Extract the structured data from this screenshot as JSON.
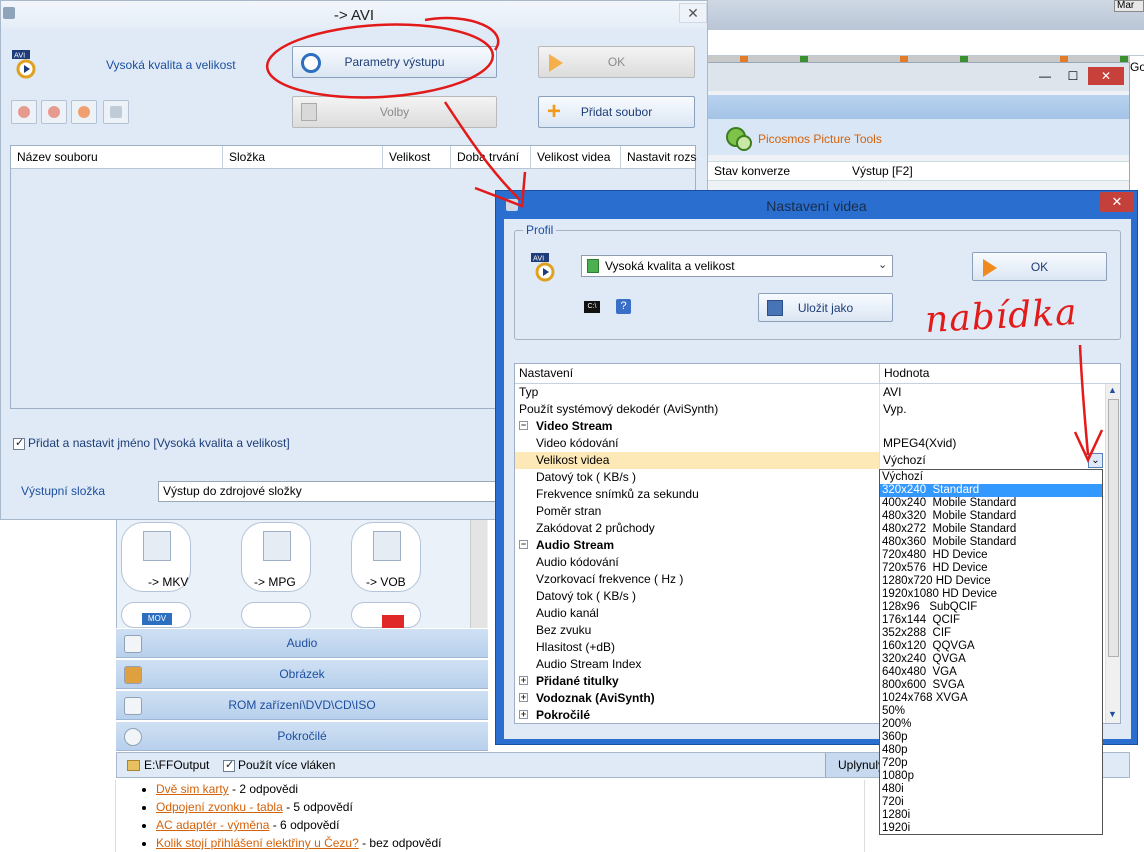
{
  "background": {
    "user_btn": "Mar",
    "gadget_letter": "Go",
    "forum_posts": [
      {
        "title": "Dvě sim karty",
        "replies": " - 2 odpovědi"
      },
      {
        "title": "Odpojení zvonku - tabla",
        "replies": " - 5 odpovědí"
      },
      {
        "title": "AC adaptér - výměna",
        "replies": " - 6 odpovědí"
      },
      {
        "title": "Kolik stojí přihlášení elektřiny u Čezu?",
        "replies": " - bez odpovědí"
      }
    ]
  },
  "picosmos": {
    "title": "Picosmos Picture Tools",
    "col_status": "Stav konverze",
    "col_output": "Výstup [F2]",
    "minimize": "—",
    "maximize": "☐",
    "close": "✕"
  },
  "main": {
    "title": "-> AVI",
    "close": "✕",
    "profile_label": "Vysoká kvalita a velikost",
    "params_button": "Parametry výstupu",
    "ok_button": "OK",
    "options_button": "Volby",
    "add_file_button": "Přidat soubor",
    "table_headers": [
      "Název souboru",
      "Složka",
      "Velikost",
      "Doba trvání",
      "Velikost videa",
      "Nastavit rozsa"
    ],
    "add_name_checkbox": "Přidat a nastavit jméno [Vysoká kvalita a velikost]",
    "output_folder_label": "Výstupní složka",
    "output_folder_value": "Výstup do zdrojové složky",
    "formats": [
      {
        "label": "-> MKV"
      },
      {
        "label": "-> MPG"
      },
      {
        "label": "-> VOB"
      }
    ],
    "format_second_row_badge": "MOV",
    "categories": [
      "Audio",
      "Obrázek",
      "ROM zařízení\\DVD\\CD\\ISO",
      "Pokročilé"
    ],
    "status_path": "E:\\FFOutput",
    "status_multithread": "Použít více vláken",
    "status_elapsed": "Uplynulý"
  },
  "dialog": {
    "title": "Nastavení videa",
    "close": "✕",
    "profile_group": "Profil",
    "profile_value": "Vysoká kvalita a velikost",
    "ok_button": "OK",
    "save_as_button": "Uložit jako",
    "help": "?",
    "cmd_label": "C:\\",
    "grid_headers": {
      "name": "Nastavení",
      "value": "Hodnota"
    },
    "rows": [
      {
        "name": "Typ",
        "value": "AVI",
        "kind": "plain"
      },
      {
        "name": "Použít systémový dekodér (AviSynth)",
        "value": "Vyp.",
        "kind": "plain"
      },
      {
        "name": "Video Stream",
        "value": "",
        "kind": "section",
        "exp": "−"
      },
      {
        "name": "Video kódování",
        "value": "MPEG4(Xvid)",
        "kind": "indent"
      },
      {
        "name": "Velikost videa",
        "value": "Výchozí",
        "kind": "indent",
        "selected": true
      },
      {
        "name": "Datový tok ( KB/s )",
        "value": "",
        "kind": "indent"
      },
      {
        "name": "Frekvence snímků za sekundu",
        "value": "",
        "kind": "indent"
      },
      {
        "name": "Poměr stran",
        "value": "",
        "kind": "indent"
      },
      {
        "name": "Zakódovat 2 průchody",
        "value": "",
        "kind": "indent"
      },
      {
        "name": "Audio Stream",
        "value": "",
        "kind": "section",
        "exp": "−"
      },
      {
        "name": "Audio kódování",
        "value": "",
        "kind": "indent"
      },
      {
        "name": "Vzorkovací frekvence ( Hz )",
        "value": "",
        "kind": "indent"
      },
      {
        "name": "Datový tok ( KB/s )",
        "value": "",
        "kind": "indent"
      },
      {
        "name": "Audio kanál",
        "value": "",
        "kind": "indent"
      },
      {
        "name": "Bez zvuku",
        "value": "",
        "kind": "indent"
      },
      {
        "name": "Hlasitost (+dB)",
        "value": "",
        "kind": "indent"
      },
      {
        "name": "Audio Stream Index",
        "value": "",
        "kind": "indent"
      },
      {
        "name": "Přidané titulky",
        "value": "",
        "kind": "section",
        "exp": "+"
      },
      {
        "name": "Vodoznak (AviSynth)",
        "value": "",
        "kind": "section",
        "exp": "+"
      },
      {
        "name": "Pokročilé",
        "value": "",
        "kind": "section",
        "exp": "+"
      }
    ],
    "dropdown": {
      "selected_index": 1,
      "options": [
        "Výchozí",
        "320x240  Standard",
        "400x240  Mobile Standard",
        "480x320  Mobile Standard",
        "480x272  Mobile Standard",
        "480x360  Mobile Standard",
        "720x480  HD Device",
        "720x576  HD Device",
        "1280x720 HD Device",
        "1920x1080 HD Device",
        "128x96   SubQCIF",
        "176x144  QCIF",
        "352x288  CIF",
        "160x120  QQVGA",
        "320x240  QVGA",
        "640x480  VGA",
        "800x600  SVGA",
        "1024x768 XVGA",
        "50%",
        "200%",
        "360p",
        "480p",
        "720p",
        "1080p",
        "480i",
        "720i",
        "1280i",
        "1920i"
      ]
    }
  },
  "annotation": {
    "text": "nabídka",
    "color": "#e21a1a"
  }
}
